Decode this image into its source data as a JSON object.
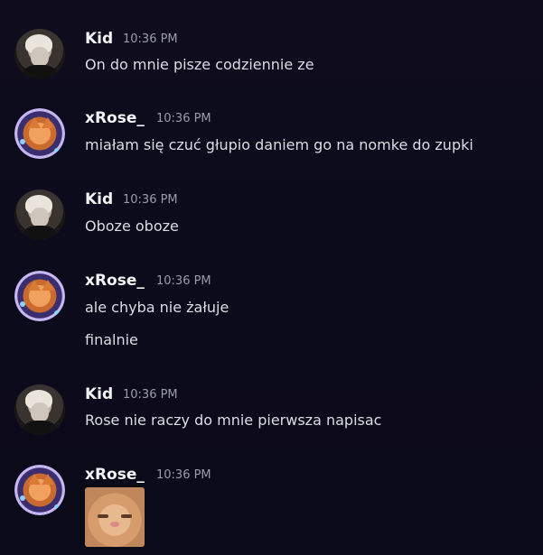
{
  "messages": [
    {
      "author": "Kid",
      "time": "10:36 PM",
      "lines": [
        "On do mnie pisze codziennie ze"
      ]
    },
    {
      "author": "xRose_",
      "time": "10:36 PM",
      "lines": [
        "miałam się czuć głupio daniem go na nomke do zupki"
      ]
    },
    {
      "author": "Kid",
      "time": "10:36 PM",
      "lines": [
        "Oboze oboze"
      ]
    },
    {
      "author": "xRose_",
      "time": "10:36 PM",
      "lines": [
        "ale chyba nie żałuje",
        "finalnie"
      ]
    },
    {
      "author": "Kid",
      "time": "10:36 PM",
      "lines": [
        "Rose nie raczy do mnie pierwsza napisac"
      ]
    },
    {
      "author": "xRose_",
      "time": "10:36 PM",
      "lines": [],
      "attachment": "cat-sticker-image"
    }
  ]
}
